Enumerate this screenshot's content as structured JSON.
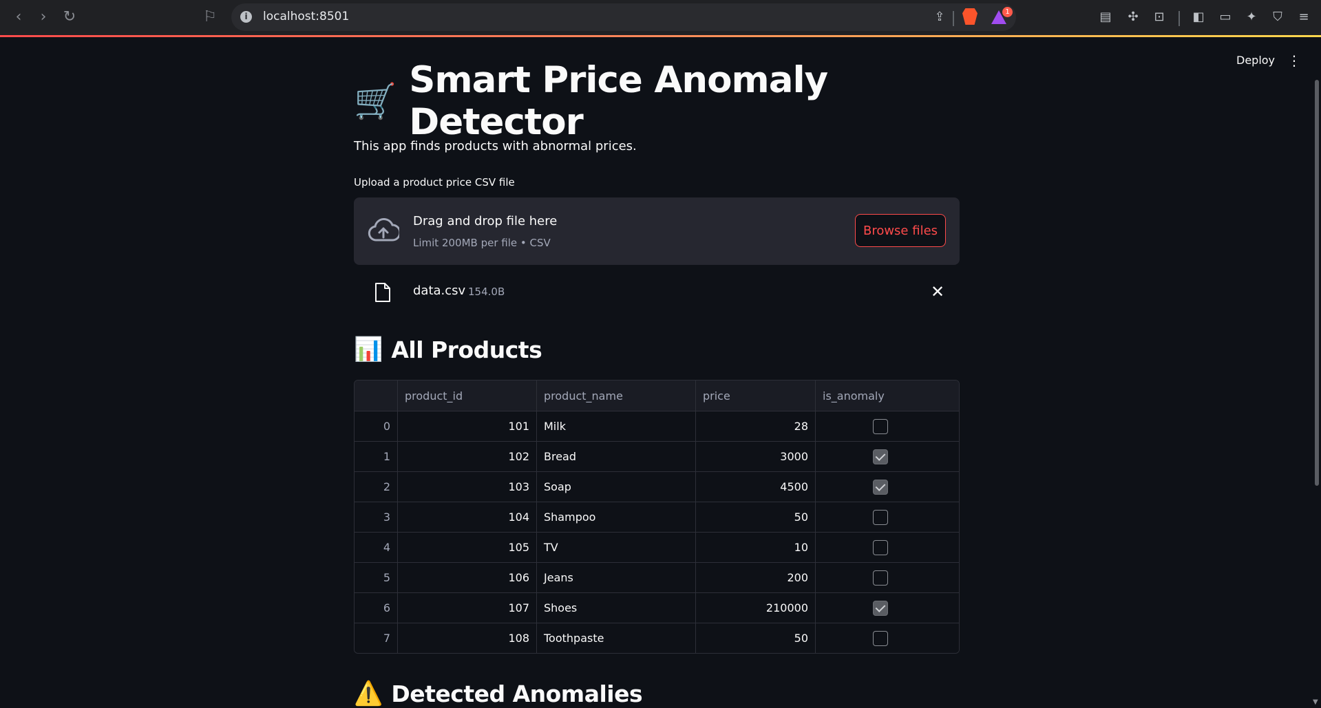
{
  "browser": {
    "url": "localhost:8501",
    "notification_count": "1"
  },
  "app": {
    "deploy_label": "Deploy",
    "title_emoji": "🛒",
    "title": "Smart Price Anomaly Detector",
    "subtitle": "This app finds products with abnormal prices.",
    "upload_label": "Upload a product price CSV file",
    "dropzone": {
      "title": "Drag and drop file here",
      "limit": "Limit 200MB per file • CSV",
      "browse_label": "Browse files"
    },
    "uploaded_file": {
      "name": "data.csv",
      "size": "154.0B"
    },
    "section_all": {
      "emoji": "📊",
      "title": "All Products"
    },
    "section_anomalies": {
      "emoji": "⚠️",
      "title": "Detected Anomalies"
    }
  },
  "table": {
    "columns": [
      "",
      "product_id",
      "product_name",
      "price",
      "is_anomaly"
    ],
    "rows": [
      {
        "index": "0",
        "product_id": "101",
        "product_name": "Milk",
        "price": "28",
        "is_anomaly": false
      },
      {
        "index": "1",
        "product_id": "102",
        "product_name": "Bread",
        "price": "3000",
        "is_anomaly": true
      },
      {
        "index": "2",
        "product_id": "103",
        "product_name": "Soap",
        "price": "4500",
        "is_anomaly": true
      },
      {
        "index": "3",
        "product_id": "104",
        "product_name": "Shampoo",
        "price": "50",
        "is_anomaly": false
      },
      {
        "index": "4",
        "product_id": "105",
        "product_name": "TV",
        "price": "10",
        "is_anomaly": false
      },
      {
        "index": "5",
        "product_id": "106",
        "product_name": "Jeans",
        "price": "200",
        "is_anomaly": false
      },
      {
        "index": "6",
        "product_id": "107",
        "product_name": "Shoes",
        "price": "210000",
        "is_anomaly": true
      },
      {
        "index": "7",
        "product_id": "108",
        "product_name": "Toothpaste",
        "price": "50",
        "is_anomaly": false
      }
    ]
  },
  "colors": {
    "background": "#0e1117",
    "accent": "#ff4b4b",
    "surface": "#262730"
  }
}
